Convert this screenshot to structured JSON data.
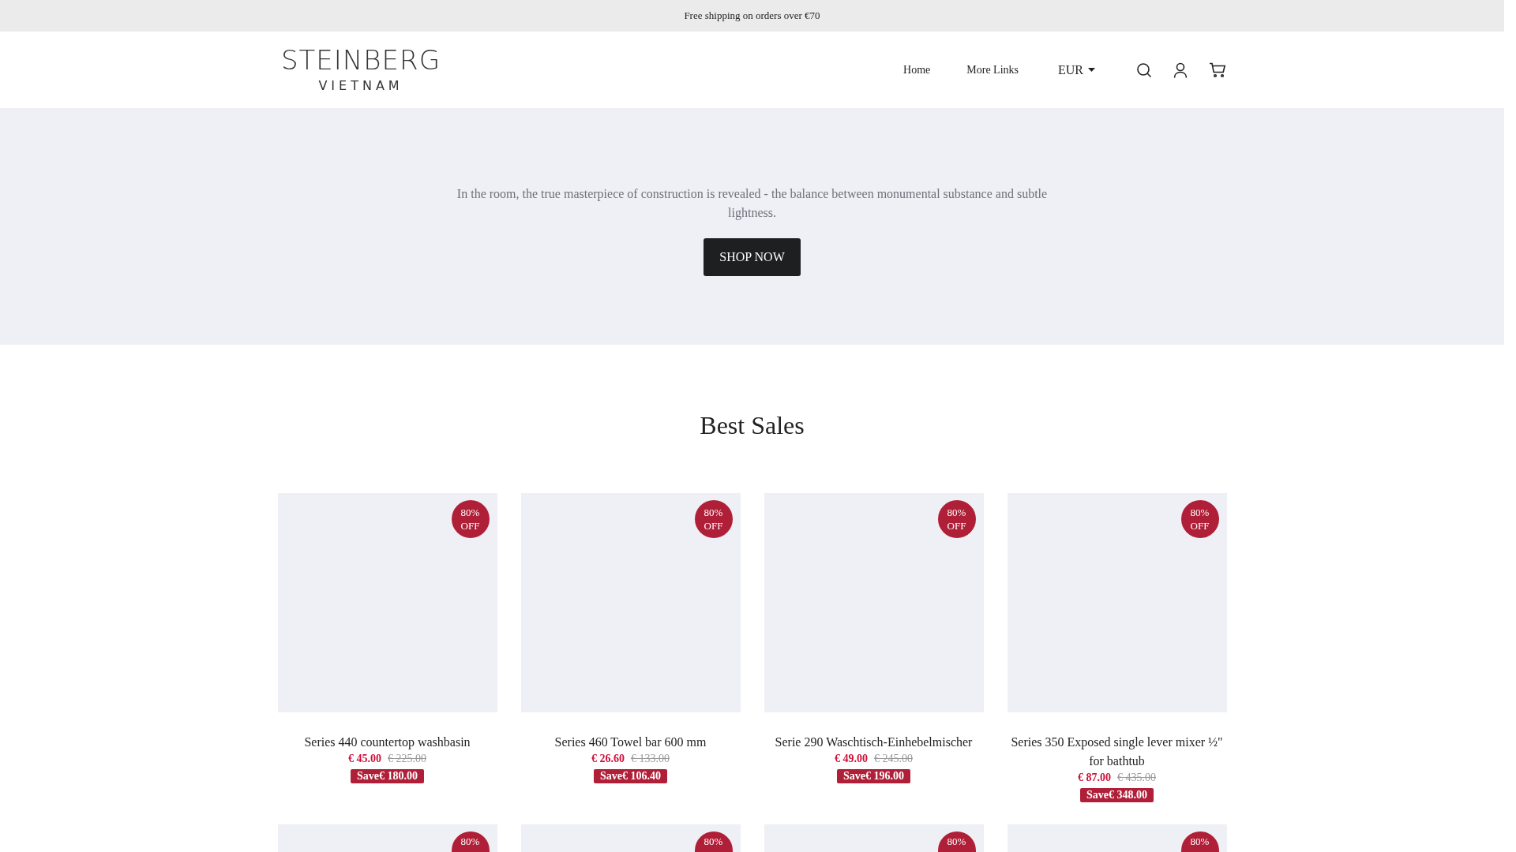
{
  "announcement": "Free shipping on orders over €70",
  "header": {
    "logo": {
      "line_1": "STEINBERG",
      "line_2": "VIETNAM"
    },
    "nav": [
      "Home",
      "More Links"
    ],
    "currency": "EUR"
  },
  "hero": {
    "text": "In the room, the true masterpiece of construction is revealed - the balance between monumental substance and subtle lightness.",
    "button": "SHOP NOW"
  },
  "best_sales": {
    "title": "Best Sales",
    "products": [
      {
        "badge": "80% OFF",
        "name": "Series 440 countertop washbasin",
        "price": "€ 45.00",
        "old_price": "€ 225.00",
        "save": "Save€ 180.00"
      },
      {
        "badge": "80% OFF",
        "name": "Series 460 Towel bar 600 mm",
        "price": "€ 26.60",
        "old_price": "€ 133.00",
        "save": "Save€ 106.40"
      },
      {
        "badge": "80% OFF",
        "name": "Serie 290 Waschtisch-Einhebelmischer",
        "price": "€ 49.00",
        "old_price": "€ 245.00",
        "save": "Save€ 196.00"
      },
      {
        "badge": "80% OFF",
        "name": "Series 350 Exposed single lever mixer ½\" for bathtub",
        "price": "€ 87.00",
        "old_price": "€ 435.00",
        "save": "Save€ 348.00"
      }
    ],
    "next_row": [
      {
        "badge": "80%"
      },
      {
        "badge": "80%"
      },
      {
        "badge": "80%"
      },
      {
        "badge": "80%"
      }
    ]
  }
}
